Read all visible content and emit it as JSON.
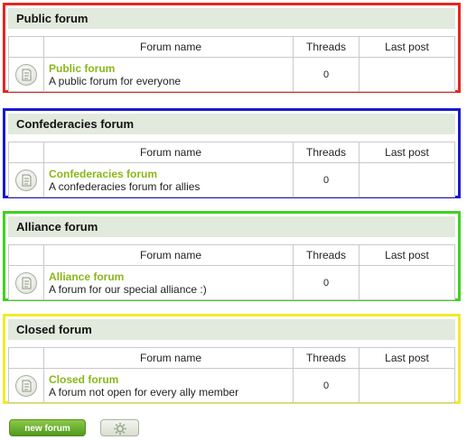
{
  "columns": {
    "forum_name": "Forum name",
    "threads": "Threads",
    "last_post": "Last post"
  },
  "forums": [
    {
      "header": "Public forum",
      "title": "Public forum",
      "description": "A public forum for everyone",
      "threads": "0",
      "last_post": "",
      "border_color": "#e5261f"
    },
    {
      "header": "Confederacies forum",
      "title": "Confederacies forum",
      "description": "A confederacies forum for allies",
      "threads": "0",
      "last_post": "",
      "border_color": "#1a1ad0"
    },
    {
      "header": "Alliance forum",
      "title": "Alliance forum",
      "description": "A forum for our special alliance :)",
      "threads": "0",
      "last_post": "",
      "border_color": "#3dd31f"
    },
    {
      "header": "Closed forum",
      "title": "Closed forum",
      "description": "A forum not open for every ally member",
      "threads": "0",
      "last_post": "",
      "border_color": "#f2ea2a"
    }
  ],
  "icons": {
    "forum": "forum-document-icon",
    "settings": "gear-icon"
  },
  "actions": {
    "new_forum_label": "new forum"
  },
  "colors": {
    "accent": "#8ab818",
    "header_bg": "#e2e9dd"
  }
}
